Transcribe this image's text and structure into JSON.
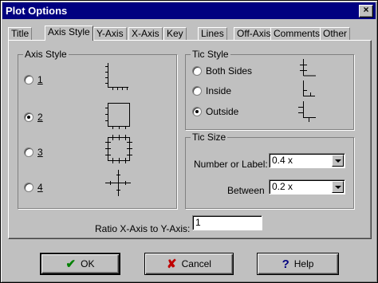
{
  "window": {
    "title": "Plot Options",
    "close_glyph": "×"
  },
  "tabs": [
    {
      "label": "Title"
    },
    {
      "label": "Axis Style",
      "active": true
    },
    {
      "label": "Y-Axis"
    },
    {
      "label": "X-Axis"
    },
    {
      "label": "Key"
    },
    {
      "label": "Lines"
    },
    {
      "label": "Off-Axis"
    },
    {
      "label": "Comments"
    },
    {
      "label": "Other"
    }
  ],
  "axis_style": {
    "title": "Axis Style",
    "options": [
      {
        "label": "1",
        "checked": false,
        "icon": "l-axis-icon"
      },
      {
        "label": "2",
        "checked": true,
        "icon": "box-axis-icon"
      },
      {
        "label": "3",
        "checked": false,
        "icon": "box-tics-icon"
      },
      {
        "label": "4",
        "checked": false,
        "icon": "cross-axis-icon"
      }
    ]
  },
  "tic_style": {
    "title": "Tic Style",
    "options": [
      {
        "label": "Both Sides",
        "checked": false,
        "icon": "tic-both-icon"
      },
      {
        "label": "Inside",
        "checked": false,
        "icon": "tic-inside-icon"
      },
      {
        "label": "Outside",
        "checked": true,
        "icon": "tic-outside-icon"
      }
    ]
  },
  "tic_size": {
    "title": "Tic Size",
    "number_label": "Number or Label:",
    "number_value": "0.4 x",
    "between_label": "Between",
    "between_value": "0.2 x"
  },
  "ratio": {
    "label": "Ratio X-Axis to Y-Axis:",
    "value": "1"
  },
  "buttons": {
    "ok": {
      "label": "OK",
      "icon": "check-icon",
      "icon_glyph": "✔",
      "color": "#008000"
    },
    "cancel": {
      "label": "Cancel",
      "icon": "x-icon",
      "icon_glyph": "✘",
      "color": "#c00000"
    },
    "help": {
      "label": "Help",
      "icon": "question-icon",
      "icon_glyph": "?",
      "color": "#000080"
    }
  }
}
